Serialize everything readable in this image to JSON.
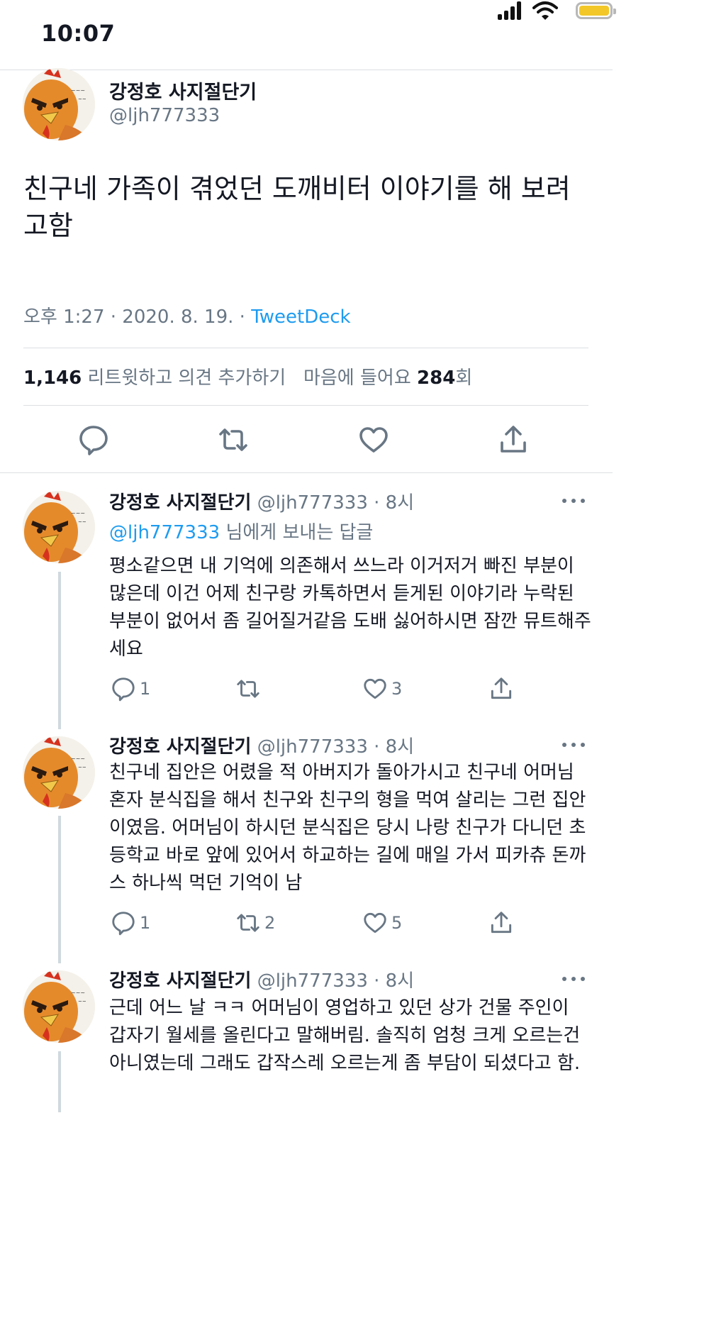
{
  "status_bar": {
    "time": "10:07"
  },
  "main_tweet": {
    "display_name": "강정호 사지절단기",
    "handle": "@ljh777333",
    "text": "친구네 가족이 겪었던 도깨비터 이야기를 해 보려고함",
    "time": "오후 1:27 · 2020. 8. 19. · ",
    "client": "TweetDeck",
    "retweet_count": "1,146",
    "retweet_label": "리트윗하고 의견 추가하기",
    "likes_prefix": "마음에 들어요 ",
    "likes_count": "284",
    "likes_suffix": "회"
  },
  "replies": [
    {
      "display_name": "강정호 사지절단기",
      "handle": "@ljh777333",
      "time": "8시",
      "replying_to_handle": "@ljh777333",
      "replying_to_suffix": " 님에게 보내는 답글",
      "text": "평소같으면 내 기억에 의존해서 쓰느라 이거저거 빠진 부분이 많은데 이건 어제 친구랑 카톡하면서 듣게된 이야기라 누락된 부분이 없어서 좀 길어질거같음 도배 싫어하시면 잠깐 뮤트해주세요",
      "reply_count": "1",
      "retweet_count": "",
      "like_count": "3"
    },
    {
      "display_name": "강정호 사지절단기",
      "handle": "@ljh777333",
      "time": "8시",
      "text": "친구네 집안은 어렸을 적 아버지가 돌아가시고 친구네 어머님 혼자 분식집을 해서 친구와 친구의 형을 먹여 살리는 그런 집안이였음. 어머님이 하시던 분식집은 당시 나랑 친구가 다니던 초등학교 바로 앞에 있어서 하교하는 길에 매일 가서 피카츄 돈까스 하나씩 먹던 기억이 남",
      "reply_count": "1",
      "retweet_count": "2",
      "like_count": "5"
    },
    {
      "display_name": "강정호 사지절단기",
      "handle": "@ljh777333",
      "time": "8시",
      "text": "근데 어느 날 ㅋㅋ 어머님이 영업하고 있던 상가 건물 주인이 갑자기 월세를 올린다고 말해버림. 솔직히 엄청 크게 오르는건 아니였는데 그래도 갑작스레 오르는게 좀 부담이 되셨다고 함."
    }
  ],
  "colors": {
    "accent": "#1d9bf0",
    "secondary_text": "#687684",
    "divider": "#dcdfe2",
    "battery": "#f3c728"
  }
}
